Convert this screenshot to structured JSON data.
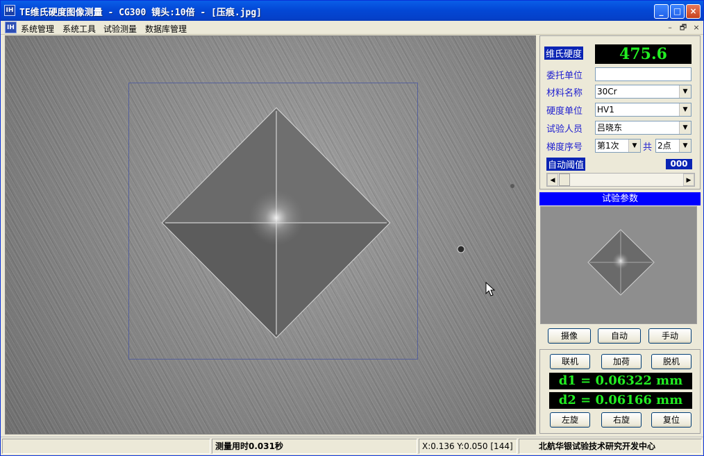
{
  "window": {
    "app_icon_text": "IH",
    "title": "TE维氏硬度图像测量 - CG300 镜头:10倍 - [压痕.jpg]",
    "controls": [
      "_",
      "□",
      "×"
    ]
  },
  "menubar": {
    "items": [
      "系统管理",
      "系统工具",
      "试验测量",
      "数据库管理"
    ],
    "mdi_controls": [
      "–",
      "🗗",
      "×"
    ]
  },
  "panel": {
    "hardness_label": "维氏硬度",
    "hardness_value": "475.6",
    "client_label": "委托单位",
    "client_value": "",
    "material_label": "材料名称",
    "material_value": "30Cr",
    "unit_label": "硬度单位",
    "unit_value": "HV1",
    "tester_label": "试验人员",
    "tester_value": "吕晓东",
    "gradient_label": "梯度序号",
    "gradient_value": "第1次",
    "total_label": "共",
    "total_value": "2点",
    "auto_threshold_label": "自动阈值",
    "auto_threshold_value": "000",
    "section_title": "试验参数"
  },
  "camera_buttons": [
    "摄像",
    "自动",
    "手动"
  ],
  "machine_buttons": [
    "联机",
    "加荷",
    "脱机"
  ],
  "measurements": {
    "d1": "d1 = 0.06322 mm",
    "d2": "d2 = 0.06166 mm"
  },
  "rotate_buttons": [
    "左旋",
    "右旋",
    "复位"
  ],
  "status": {
    "time": "测量用时0.031秒",
    "coords": "X:0.136 Y:0.050 [144]",
    "org": "北航华银试验技术研究开发中心"
  },
  "icons": {
    "dropdown": "chevron-down-icon",
    "scroll_left": "arrow-left-icon",
    "scroll_right": "arrow-right-icon",
    "cursor": "mouse-pointer-icon"
  }
}
